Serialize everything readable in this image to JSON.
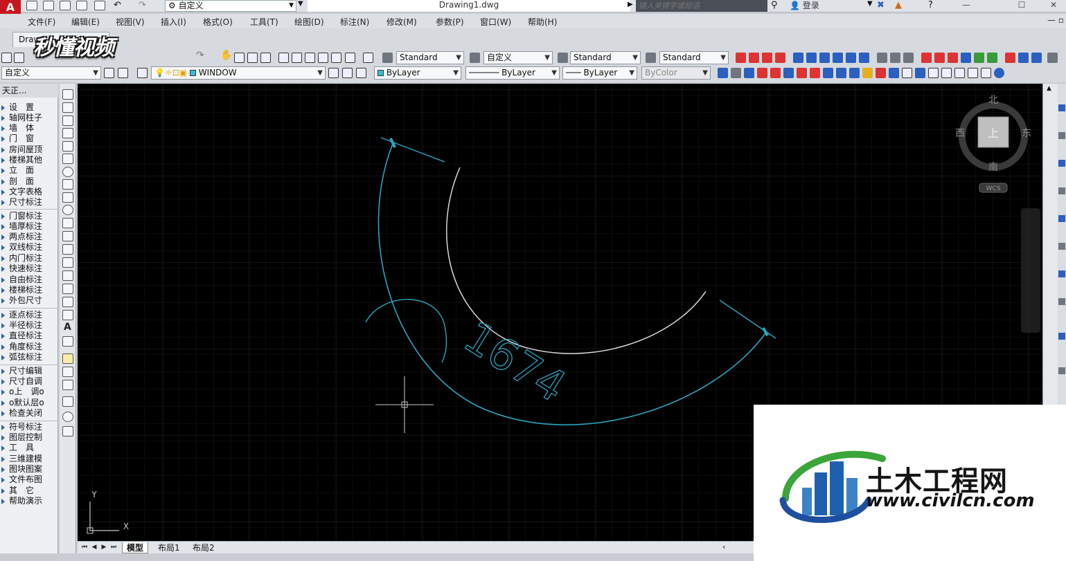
{
  "titlebar": {
    "workspace": "自定义",
    "document_title": "Drawing1.dwg",
    "search_placeholder": "键入关键字或短语",
    "login": "登录"
  },
  "menu": [
    {
      "label": "文件(F)"
    },
    {
      "label": "编辑(E)"
    },
    {
      "label": "视图(V)"
    },
    {
      "label": "插入(I)"
    },
    {
      "label": "格式(O)"
    },
    {
      "label": "工具(T)"
    },
    {
      "label": "绘图(D)"
    },
    {
      "label": "标注(N)"
    },
    {
      "label": "修改(M)"
    },
    {
      "label": "参数(P)"
    },
    {
      "label": "窗口(W)"
    },
    {
      "label": "帮助(H)"
    }
  ],
  "document_tab": "Draw",
  "watermark": "秒懂视频",
  "styles_toolbar": {
    "text_style": "Standard",
    "dim_style": "自定义",
    "table_style": "Standard",
    "multileader_style": "Standard"
  },
  "layers_toolbar": {
    "workspace_combo": "自定义",
    "layer": "WINDOW",
    "color": "ByLayer",
    "linetype": "ByLayer",
    "lineweight": "ByLayer",
    "plot_style": "ByColor"
  },
  "tz_panel": {
    "header": "天正...",
    "groups": [
      [
        "设　置",
        "轴网柱子",
        "墙　体",
        "门　窗",
        "房间屋顶",
        "楼梯其他",
        "立　面",
        "剖　面",
        "文字表格",
        "尺寸标注"
      ],
      [
        "门窗标注",
        "墙厚标注",
        "两点标注",
        "双线标注",
        "内门标注",
        "快速标注",
        "自由标注",
        "楼梯标注",
        "外包尺寸"
      ],
      [
        "逐点标注",
        "半径标注",
        "直径标注",
        "角度标注",
        "弧弦标注"
      ],
      [
        "尺寸编辑",
        "尺寸自调",
        "o上　调o",
        "o默认层o",
        "检查关闭"
      ],
      [
        "符号标注",
        "图层控制",
        "工　具",
        "三维建模",
        "图块图案",
        "文件布图",
        "其　它",
        "帮助演示"
      ]
    ]
  },
  "drawing": {
    "dimension_text": "1674",
    "viewcube": {
      "north": "北",
      "south": "南",
      "west": "西",
      "east": "东",
      "face": "上",
      "wcs": "WCS"
    },
    "ucs": {
      "x": "X",
      "y": "Y"
    },
    "colors": {
      "background": "#000000",
      "dimension": "#29a6c0",
      "arc": "#d8d8d8",
      "grid": "#1c1c1c"
    }
  },
  "layout_tabs": [
    {
      "label": "模型",
      "active": true
    },
    {
      "label": "布局1",
      "active": false
    },
    {
      "label": "布局2",
      "active": false
    }
  ],
  "site_logo": {
    "name": "土木工程网",
    "url": "www.civilcn.com"
  }
}
